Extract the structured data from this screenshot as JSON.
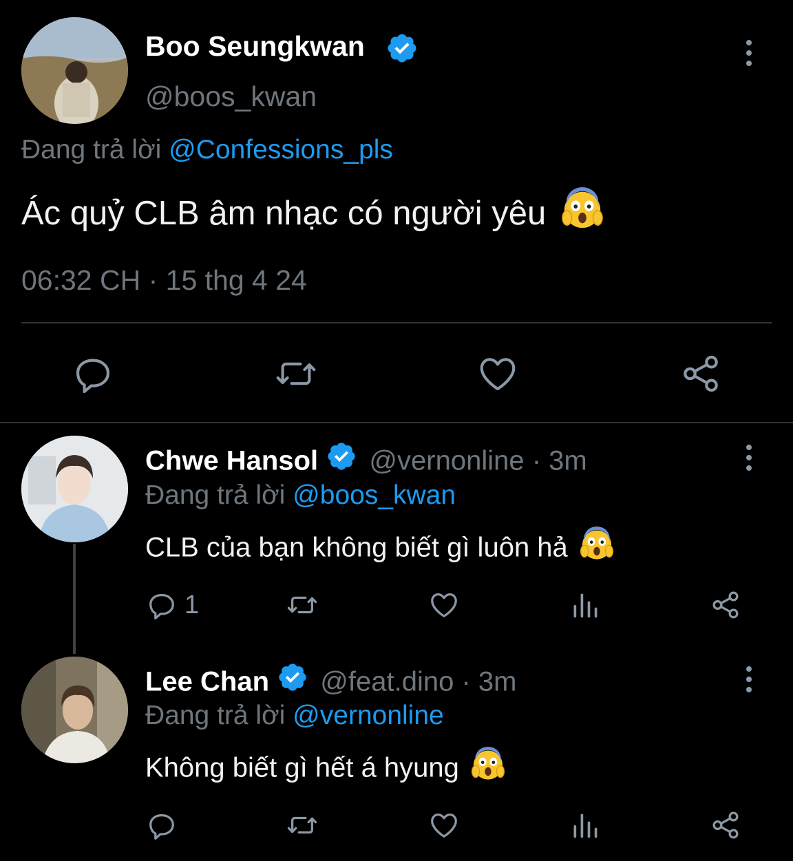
{
  "main_tweet": {
    "author_name": "Boo Seungkwan",
    "handle": "@boos_kwan",
    "reply_prefix": "Đang trả lời",
    "reply_to": "@Confessions_pls",
    "text": "Ác quỷ CLB âm nhạc có người yêu",
    "timestamp": "06:32 CH · 15 thg 4 24"
  },
  "replies": [
    {
      "author_name": "Chwe Hansol",
      "handle": "@vernonline",
      "time": "· 3m",
      "reply_prefix": "Đang trả lời",
      "reply_to": "@boos_kwan",
      "text": "CLB của bạn không biết gì luôn hả",
      "reply_count": "1"
    },
    {
      "author_name": "Lee Chan",
      "handle": "@feat.dino",
      "time": "· 3m",
      "reply_prefix": "Đang trả lời",
      "reply_to": "@vernonline",
      "text": "Không biết gì hết á hyung"
    }
  ],
  "icons": {
    "verified": "verified-badge-icon",
    "more": "more-options-icon",
    "reply": "reply-icon",
    "retweet": "retweet-icon",
    "like": "like-icon",
    "share": "share-icon",
    "views": "views-icon",
    "emoji": "face-screaming-in-fear-emoji"
  },
  "colors": {
    "background": "#000000",
    "accent": "#1d9bf0",
    "muted": "#6e767d",
    "divider": "#2f3336"
  }
}
